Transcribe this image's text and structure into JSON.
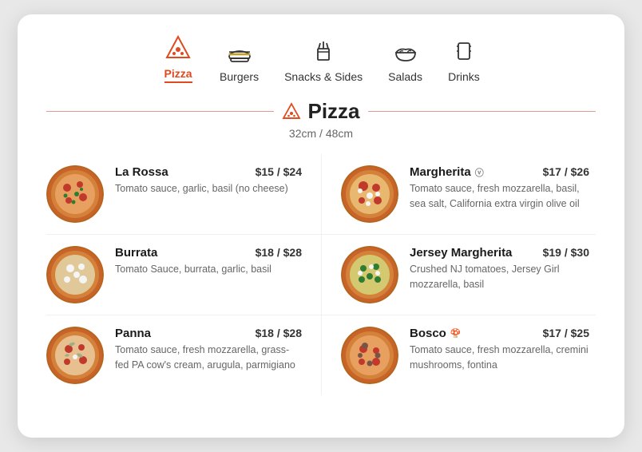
{
  "nav": {
    "items": [
      {
        "id": "pizza",
        "label": "Pizza",
        "active": true
      },
      {
        "id": "burgers",
        "label": "Burgers",
        "active": false
      },
      {
        "id": "snacks",
        "label": "Snacks & Sides",
        "active": false
      },
      {
        "id": "salads",
        "label": "Salads",
        "active": false
      },
      {
        "id": "drinks",
        "label": "Drinks",
        "active": false
      }
    ]
  },
  "section": {
    "title": "Pizza",
    "subtitle": "32cm / 48cm"
  },
  "menu": {
    "items": [
      {
        "name": "La Rossa",
        "description": "Tomato sauce, garlic, basil (no cheese)",
        "price": "$15 / $24",
        "badge": "",
        "col": "left"
      },
      {
        "name": "Margherita",
        "description": "Tomato sauce, fresh mozzarella, basil, sea salt, California extra virgin olive oil",
        "price": "$17 / $26",
        "badge": "ⓥ",
        "col": "right"
      },
      {
        "name": "Burrata",
        "description": "Tomato Sauce, burrata, garlic, basil",
        "price": "$18 / $28",
        "badge": "",
        "col": "left"
      },
      {
        "name": "Jersey Margherita",
        "description": "Crushed NJ tomatoes, Jersey Girl mozzarella, basil",
        "price": "$19 / $30",
        "badge": "",
        "col": "right"
      },
      {
        "name": "Panna",
        "description": "Tomato sauce, fresh mozzarella, grass-fed PA cow's cream, arugula, parmigiano",
        "price": "$18 / $28",
        "badge": "",
        "col": "left"
      },
      {
        "name": "Bosco",
        "description": "Tomato sauce, fresh mozzarella, cremini mushrooms, fontina",
        "price": "$17 / $25",
        "badge": "🍄",
        "col": "right"
      }
    ]
  }
}
